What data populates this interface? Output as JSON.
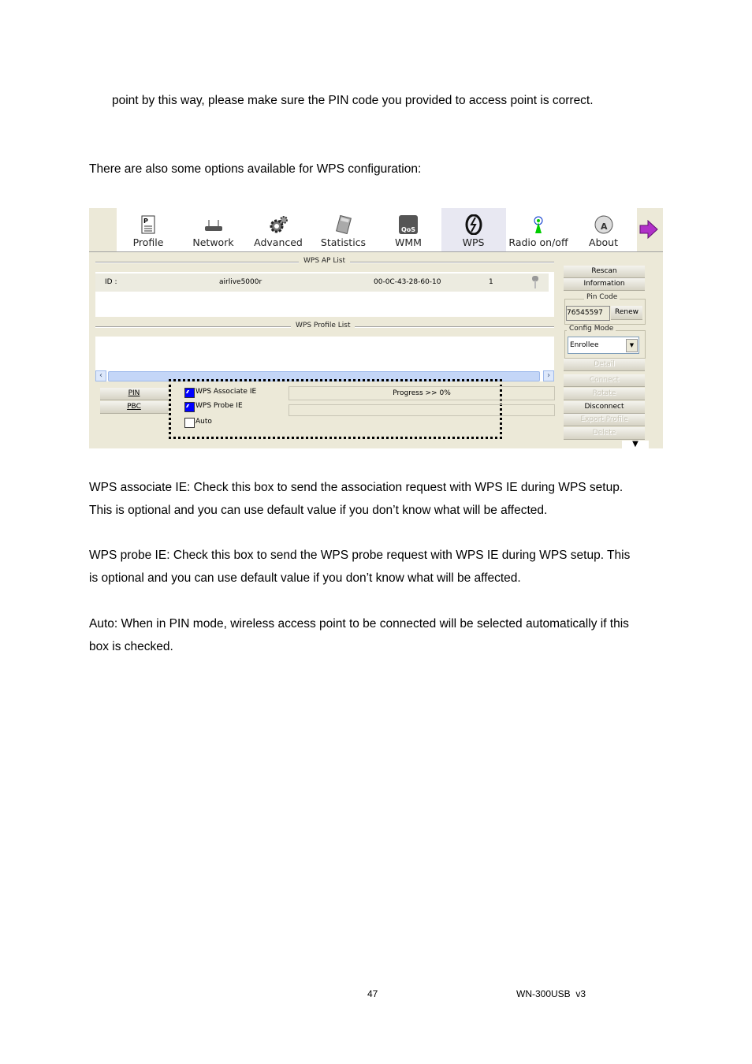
{
  "doc": {
    "para1": "point by this way, please make sure the PIN code you provided to access point is correct.",
    "para2": "There are also some options available for WPS configuration:",
    "para3a": "WPS associate IE: Check this box to send the association request with WPS IE during WPS setup.",
    "para3b": "This is optional and you can use default value if you don’t know what will be affected.",
    "para4a": "WPS probe IE: Check this box to send the WPS probe request with WPS IE during WPS setup. This",
    "para4b": "is optional and you can use default value if you don’t know what will be affected.",
    "para5a": "Auto: When in PIN mode, wireless access point to be connected will be selected automatically if this",
    "para5b": "box is checked.",
    "page_number": "47",
    "model": "WN-300USB  v3"
  },
  "app": {
    "toolbar": [
      {
        "label": "Profile",
        "icon": "profile-icon"
      },
      {
        "label": "Network",
        "icon": "network-icon"
      },
      {
        "label": "Advanced",
        "icon": "advanced-icon"
      },
      {
        "label": "Statistics",
        "icon": "statistics-icon"
      },
      {
        "label": "WMM",
        "icon": "wmm-icon",
        "icon_text": "QoS"
      },
      {
        "label": "WPS",
        "icon": "wps-icon",
        "active": true
      },
      {
        "label": "Radio on/off",
        "icon": "radio-icon"
      },
      {
        "label": "About",
        "icon": "about-icon"
      }
    ],
    "ap_list_title": "WPS AP List",
    "ap_row": {
      "id_label": "ID :",
      "ssid": "airlive5000r",
      "bssid": "00-0C-43-28-60-10",
      "channel": "1"
    },
    "profile_list_title": "WPS Profile List",
    "pin_button": "PIN",
    "pbc_button": "PBC",
    "options": [
      {
        "label": "WPS Associate IE",
        "checked": true
      },
      {
        "label": "WPS Probe IE",
        "checked": true
      },
      {
        "label": "Auto",
        "checked": false
      }
    ],
    "progress_text": "Progress >> 0%",
    "progress_value": 0,
    "right": {
      "rescan": "Rescan",
      "information": "Information",
      "pin_code_title": "Pin Code",
      "pin_code": "76545597",
      "renew": "Renew",
      "config_mode_title": "Config Mode",
      "config_mode": "Enrollee",
      "detail": "Detail",
      "connect": "Connect",
      "rotate": "Rotate",
      "disconnect": "Disconnect",
      "export_profile": "Export Profile",
      "delete": "Delete"
    },
    "accent": "#0000ff"
  }
}
